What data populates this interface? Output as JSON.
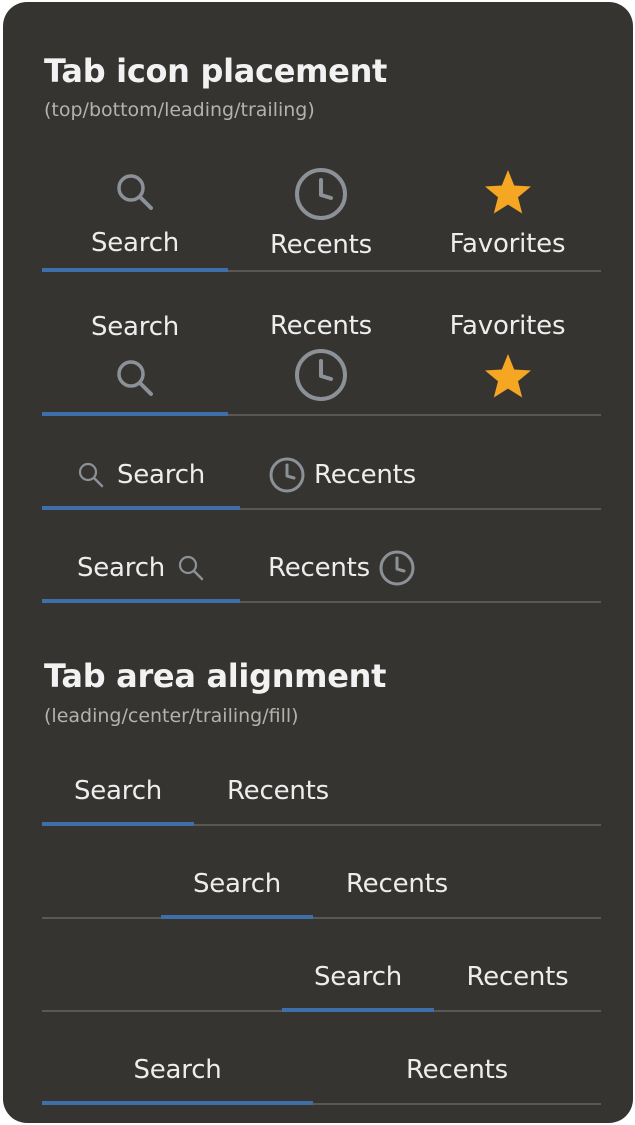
{
  "sections": {
    "icon_placement": {
      "title": "Tab icon placement",
      "subtitle": "(top/bottom/leading/trailing)"
    },
    "area_alignment": {
      "title": "Tab area alignment",
      "subtitle": "(leading/center/trailing/fill)"
    }
  },
  "tabs": {
    "search": "Search",
    "recents": "Recents",
    "favorites": "Favorites"
  },
  "icons": {
    "search": "search-icon",
    "recents": "clock-icon",
    "favorites": "star-icon"
  },
  "colors": {
    "panel_background": "#363431",
    "indicator": "#3f6fa8",
    "star": "#f5a623",
    "icon_gray": "#8b9197"
  },
  "selected_tab": "Search"
}
